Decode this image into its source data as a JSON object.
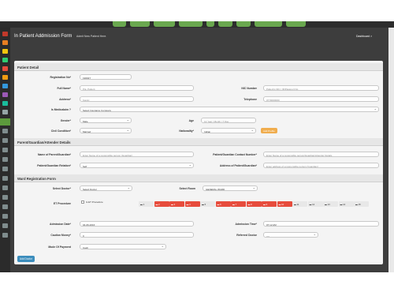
{
  "header": {
    "title": "In Patient Addmission Form",
    "subtitle": "Admit New Patient Here.",
    "breadcrumb": "Dashboard >"
  },
  "sections": {
    "patient_detail": "Patient Detail",
    "guardian": "Parent/Guardian/Attender Details",
    "ward": "Ward Registration Form"
  },
  "patient": {
    "reg_no_label": "Registration No*",
    "reg_no_value": "190027",
    "full_name_label": "Full Name*",
    "full_name_placeholder": "P.E. Patient",
    "nic_label": "NIC Number",
    "nic_placeholder": "Patient's NIC / ID/Passport No",
    "address_label": "Address*",
    "address_placeholder": "Kandy",
    "telephone_label": "Telephone",
    "telephone_placeholder": "0770000000",
    "insurance_label": "Is Medicalaim ?",
    "insurance_value": "Select Insurance Company",
    "gender_label": "Gender*",
    "gender_value": "Male",
    "age_label": "Age",
    "age_placeholder": "12 Year / Month / T Day",
    "civil_label": "Civil Condition*",
    "civil_value": "Married",
    "nationality_label": "Nationality*",
    "nationality_value": "Indian",
    "add_profile_label": "Add Profile"
  },
  "guardian": {
    "name_label": "Name of Parent/Guardian*",
    "name_placeholder": "Enter Name of a responsible person (Guardian)",
    "contact_label": "Patient/Guardian Contact Number*",
    "contact_placeholder": "Enter Name of a responsible person/Guardian/Attender Details",
    "relation_label": "Patient/Guardian Relation*",
    "relation_value": "Self",
    "address_label": "Address of Patient/Guardian*",
    "address_placeholder": "Enter address of a responsible person (Guardian)"
  },
  "ward": {
    "doctor_label": "Select Doctor*",
    "doctor_value": "Select Doctor",
    "room_label": "Select Room",
    "room_value": "GENERAL WARD",
    "et_label": "ET Procedure",
    "et_check_label": "Is ET Procedure",
    "beds": [
      "1",
      "2",
      "3",
      "4",
      "5",
      "6",
      "7",
      "8",
      "9",
      "10",
      "11",
      "12",
      "13",
      "14",
      "15"
    ],
    "bed_status": [
      "free",
      "occupied",
      "occupied",
      "occupied",
      "free",
      "occupied",
      "occupied",
      "occupied",
      "occupied",
      "occupied",
      "free",
      "free",
      "free",
      "free",
      "free"
    ],
    "admission_date_label": "Admission Date*",
    "admission_date_value": "04-06-2016",
    "admission_time_label": "Admission Time*",
    "admission_time_value": "07:12 AM",
    "caution_label": "Caution Money*",
    "caution_value": "0",
    "referred_label": "Referred Doctor",
    "referred_value": "----",
    "payment_label": "Mode Of Payment",
    "payment_value": "Cash",
    "add_doctor_label": "Add Doctor"
  },
  "colors": {
    "accent_green": "#6aa84f",
    "occupied_red": "#e74c3c",
    "button_blue": "#3c8dbc",
    "button_orange": "#f0ad4e"
  }
}
